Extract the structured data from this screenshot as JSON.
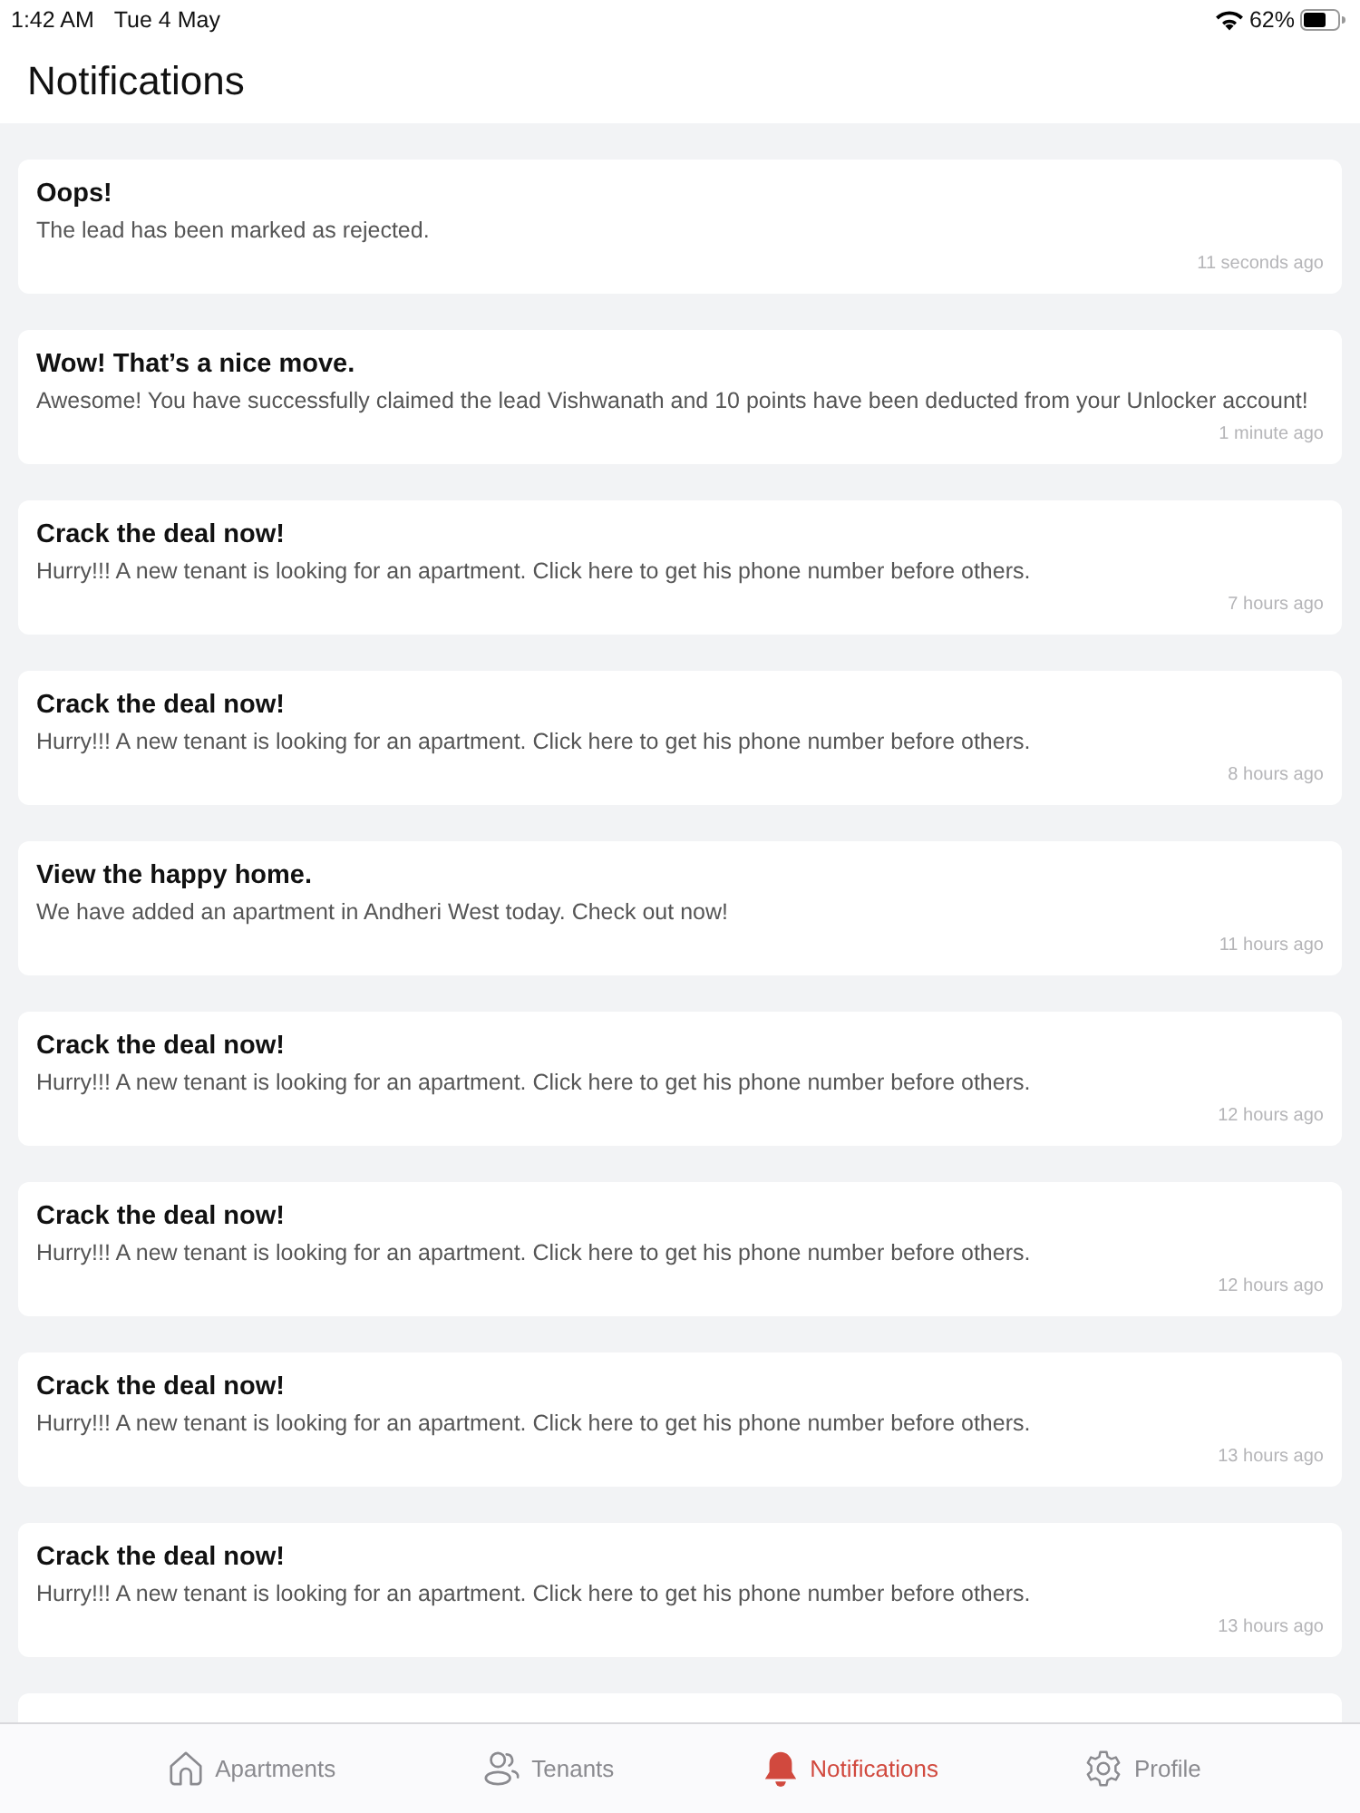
{
  "status_bar": {
    "time": "1:42 AM",
    "date": "Tue 4 May",
    "battery": "62%"
  },
  "header": {
    "title": "Notifications"
  },
  "notifications": [
    {
      "title": "Oops!",
      "message": "The lead has been marked as rejected.",
      "time": "11 seconds ago"
    },
    {
      "title": "Wow! That’s a nice move.",
      "message": "Awesome! You have successfully claimed the lead Vishwanath and 10 points have been deducted from your Unlocker account!",
      "time": "1 minute ago"
    },
    {
      "title": "Crack the deal now!",
      "message": "Hurry!!! A new tenant is looking for an apartment. Click here to get his phone number before others.",
      "time": "7 hours ago"
    },
    {
      "title": "Crack the deal now!",
      "message": "Hurry!!! A new tenant is looking for an apartment. Click here to get his phone number before others.",
      "time": "8 hours ago"
    },
    {
      "title": "View the happy home.",
      "message": "We have added an apartment in Andheri West today. Check out now!",
      "time": "11 hours ago"
    },
    {
      "title": "Crack the deal now!",
      "message": "Hurry!!! A new tenant is looking for an apartment. Click here to get his phone number before others.",
      "time": "12 hours ago"
    },
    {
      "title": "Crack the deal now!",
      "message": "Hurry!!! A new tenant is looking for an apartment. Click here to get his phone number before others.",
      "time": "12 hours ago"
    },
    {
      "title": "Crack the deal now!",
      "message": "Hurry!!! A new tenant is looking for an apartment. Click here to get his phone number before others.",
      "time": "13 hours ago"
    },
    {
      "title": "Crack the deal now!",
      "message": "Hurry!!! A new tenant is looking for an apartment. Click here to get his phone number before others.",
      "time": "13 hours ago"
    }
  ],
  "tab_bar": [
    {
      "label": "Apartments",
      "selected": false
    },
    {
      "label": "Tenants",
      "selected": false
    },
    {
      "label": "Notifications",
      "selected": true
    },
    {
      "label": "Profile",
      "selected": false
    }
  ]
}
